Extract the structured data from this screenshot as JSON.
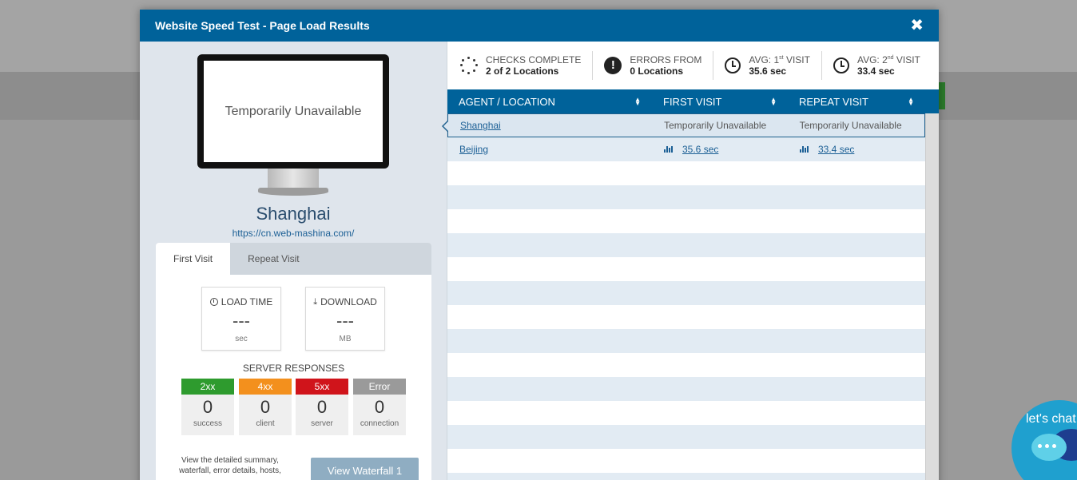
{
  "modal": {
    "title": "Website Speed Test - Page Load Results",
    "close_label": "✖"
  },
  "preview": {
    "screen_text": "Temporarily Unavailable",
    "location": "Shanghai",
    "url": "https://cn.web-mashina.com/"
  },
  "tabs": [
    {
      "label": "First Visit",
      "active": true
    },
    {
      "label": "Repeat Visit",
      "active": false
    }
  ],
  "metrics": {
    "load_time": {
      "label": "LOAD TIME",
      "value": "---",
      "unit": "sec"
    },
    "download": {
      "label": "DOWNLOAD",
      "value": "---",
      "unit": "MB"
    }
  },
  "server_responses": {
    "title": "SERVER RESPONSES",
    "items": [
      {
        "code": "2xx",
        "value": "0",
        "label": "success",
        "color": "#2e9b2e"
      },
      {
        "code": "4xx",
        "value": "0",
        "label": "client",
        "color": "#f3901d"
      },
      {
        "code": "5xx",
        "value": "0",
        "label": "server",
        "color": "#d0141b"
      },
      {
        "code": "Error",
        "value": "0",
        "label": "connection",
        "color": "#9a9a9a"
      }
    ]
  },
  "footer": {
    "description": "View the detailed summary, waterfall, error details, hosts,",
    "waterfall_button": "View Waterfall 1"
  },
  "summary": {
    "checks": {
      "label": "CHECKS COMPLETE",
      "value": "2 of 2 Locations"
    },
    "errors": {
      "label": "ERRORS FROM",
      "value": "0 Locations"
    },
    "avg_first": {
      "label": "AVG: 1",
      "sup": "st",
      "suffix": " VISIT",
      "value": "35.6 sec"
    },
    "avg_repeat": {
      "label": "AVG: 2",
      "sup": "nd",
      "suffix": " VISIT",
      "value": "33.4 sec"
    }
  },
  "table": {
    "columns": [
      "AGENT / LOCATION",
      "FIRST VISIT",
      "REPEAT VISIT"
    ],
    "rows": [
      {
        "location": "Shanghai",
        "first": "Temporarily Unavailable",
        "repeat": "Temporarily Unavailable"
      },
      {
        "location": "Beijing",
        "first": "35.6 sec",
        "repeat": "33.4 sec"
      }
    ]
  },
  "chat": {
    "label": "let's chat"
  },
  "colors": {
    "accent": "#00629a",
    "panel": "#dfe5ec"
  }
}
